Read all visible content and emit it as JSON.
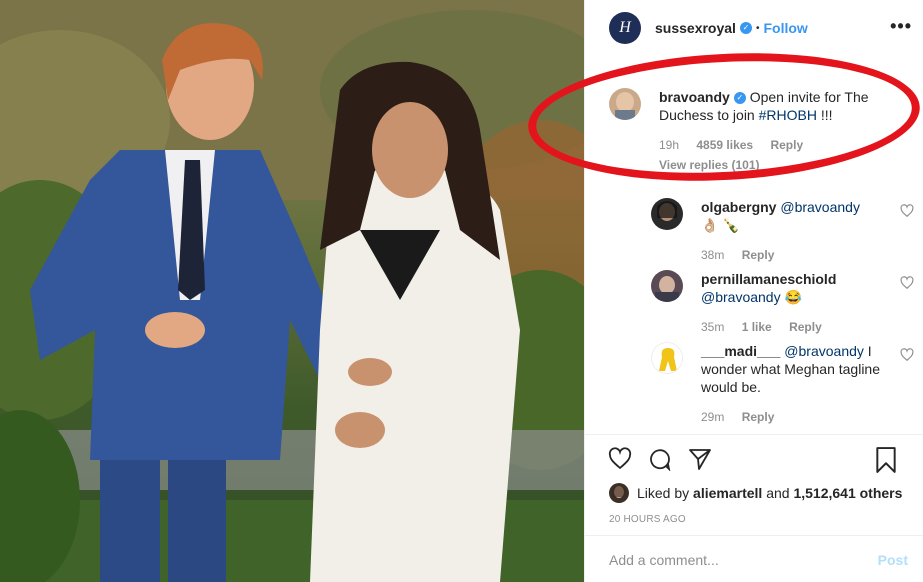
{
  "post": {
    "author": "sussexroyal",
    "author_avatar_letter": "H",
    "follow_label": "Follow",
    "more_label": "•••"
  },
  "main_comment": {
    "user": "bravoandy",
    "text": "Open invite for The Duchess to join ",
    "hashtag": "#RHOBH",
    "tail": " !!!",
    "time": "19h",
    "likes": "4859 likes",
    "reply": "Reply",
    "view_replies": "View replies (101)"
  },
  "replies": [
    {
      "user": "olgabergny",
      "mention": "@bravoandy",
      "text": " 👌🏼 🍾",
      "time": "38m",
      "likes": "",
      "reply": "Reply"
    },
    {
      "user": "pernillamaneschiold",
      "mention": "@bravoandy",
      "text": " 😂",
      "time": "35m",
      "likes": "1 like",
      "reply": "Reply"
    },
    {
      "user": "___madi___",
      "mention": "@bravoandy",
      "text": " I wonder what Meghan tagline would be.",
      "time": "29m",
      "likes": "",
      "reply": "Reply"
    }
  ],
  "liked_by": {
    "prefix": "Liked by ",
    "user": "aliemartell",
    "middle": " and ",
    "count": "1,512,641 others"
  },
  "timestamp": "20 HOURS AGO",
  "add_comment": {
    "placeholder": "Add a comment...",
    "post_label": "Post"
  },
  "colors": {
    "link_blue": "#3897f0",
    "annotation_red": "#e3141b",
    "muted": "#8e8e8e"
  }
}
